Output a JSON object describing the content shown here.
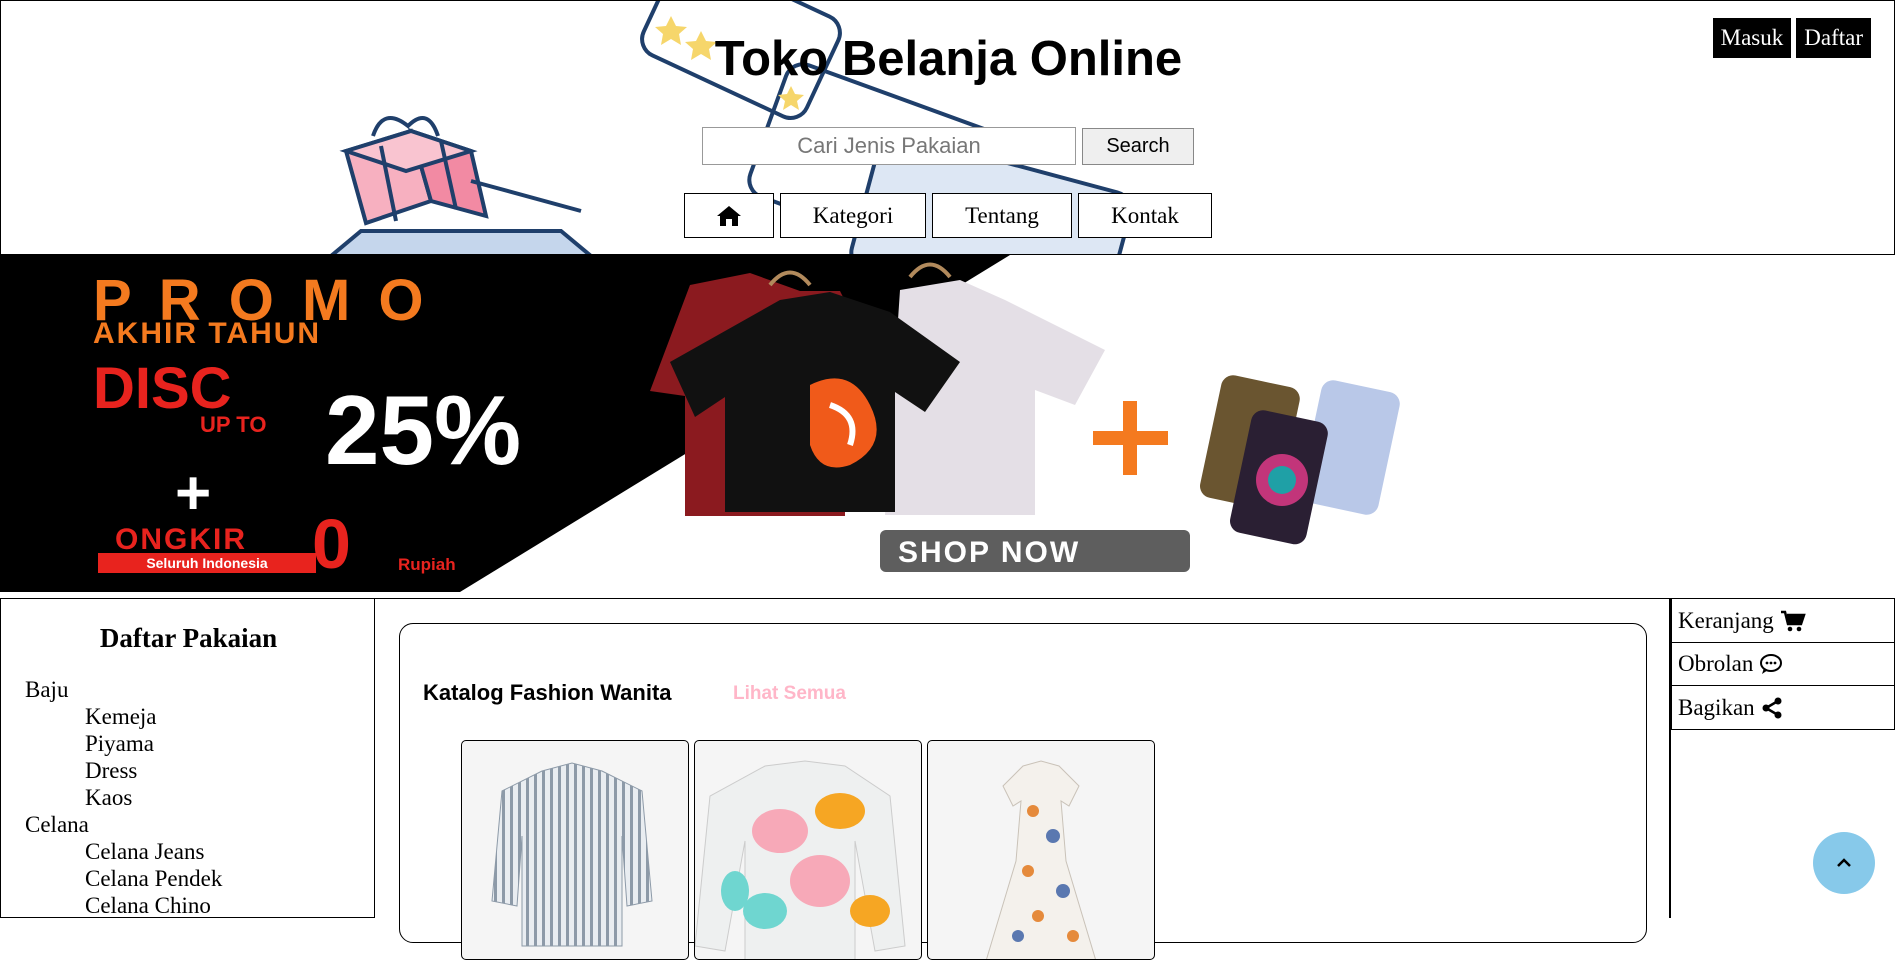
{
  "header": {
    "title": "Toko Belanja Online",
    "auth": {
      "login_label": "Masuk",
      "register_label": "Daftar"
    },
    "search": {
      "placeholder": "Cari Jenis Pakaian",
      "button_label": "Search"
    },
    "nav": {
      "home_icon": "home-icon",
      "items": [
        "Kategori",
        "Tentang",
        "Kontak"
      ]
    }
  },
  "banner": {
    "promo": "P R O M O",
    "subtitle": "AKHIR TAHUN",
    "disc": "DISC",
    "up_to": "UP TO",
    "percent": "25%",
    "plus": "+",
    "ongkir": "ONGKIR",
    "zero": "0",
    "region": "Seluruh Indonesia",
    "rupiah": "Rupiah",
    "cta": "SHOP NOW",
    "colors": {
      "orange": "#f47a1f",
      "red": "#e8231e",
      "black": "#000000"
    }
  },
  "sidebar": {
    "title": "Daftar Pakaian",
    "groups": [
      {
        "label": "Baju",
        "items": [
          "Kemeja",
          "Piyama",
          "Dress",
          "Kaos"
        ]
      },
      {
        "label": "Celana",
        "items": [
          "Celana Jeans",
          "Celana Pendek",
          "Celana Chino"
        ]
      }
    ]
  },
  "catalog": {
    "title": "Katalog Fashion Wanita",
    "see_all": "Lihat Semua",
    "see_all_color": "#ffb6c8",
    "products": [
      "striped-shirt-image",
      "colorful-sweater-image",
      "floral-dress-image"
    ]
  },
  "right_panel": {
    "items": [
      {
        "label": "Keranjang",
        "icon": "cart-icon"
      },
      {
        "label": "Obrolan",
        "icon": "chat-icon"
      },
      {
        "label": "Bagikan",
        "icon": "share-icon"
      }
    ]
  },
  "scroll_top": {
    "icon": "chevron-up-icon",
    "color": "#87c9ea"
  }
}
